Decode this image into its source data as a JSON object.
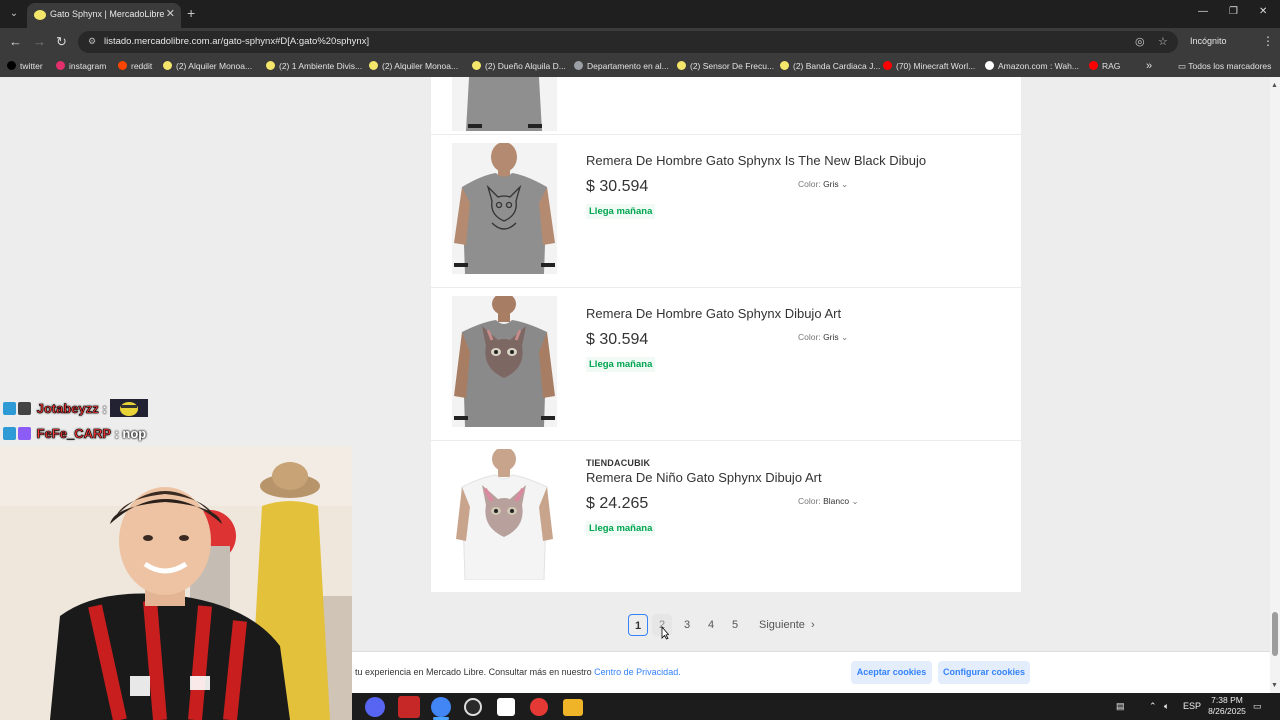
{
  "browser": {
    "tab_title": "Gato Sphynx | MercadoLibre",
    "url": "listado.mercadolibre.com.ar/gato-sphynx#D[A:gato%20sphynx]",
    "incognito_label": "Incógnito",
    "bookmarks": [
      {
        "label": "twitter",
        "icon": "x-icon",
        "color": "#000000"
      },
      {
        "label": "instagram",
        "icon": "instagram-icon",
        "color": "#e1306c"
      },
      {
        "label": "reddit",
        "icon": "reddit-icon",
        "color": "#ff4500"
      },
      {
        "label": "(2) Alquiler Monoa...",
        "icon": "ml-icon",
        "color": "#f3e66b"
      },
      {
        "label": "(2) 1 Ambiente Divis...",
        "icon": "ml-icon",
        "color": "#f3e66b"
      },
      {
        "label": "(2) Alquiler Monoa...",
        "icon": "ml-icon",
        "color": "#f3e66b"
      },
      {
        "label": "(2) Dueño Alquila D...",
        "icon": "ml-icon",
        "color": "#f3e66b"
      },
      {
        "label": "Departamento en al...",
        "icon": "house-icon",
        "color": "#9aa0a6"
      },
      {
        "label": "(2) Sensor De Frecu...",
        "icon": "ml-icon",
        "color": "#f3e66b"
      },
      {
        "label": "(2) Banda Cardiaca J...",
        "icon": "ml-icon",
        "color": "#f3e66b"
      },
      {
        "label": "(70) Minecraft Worl...",
        "icon": "youtube-icon",
        "color": "#ff0000"
      },
      {
        "label": "Amazon.com : Wah...",
        "icon": "amazon-icon",
        "color": "#ffffff"
      },
      {
        "label": "RAG",
        "icon": "youtube-icon",
        "color": "#ff0000"
      }
    ],
    "bookmarks_folder": "Todos los marcadores"
  },
  "products": [
    {
      "seller": "",
      "title": "Remera De Hombre Gato Sphynx Is The New Black Dibujo",
      "price": "$ 30.594",
      "shipping": "Llega mañana",
      "color_label": "Color:",
      "color_value": "Gris",
      "shirt_color": "#8f8f8f"
    },
    {
      "seller": "",
      "title": "Remera De Hombre Gato Sphynx Dibujo Art",
      "price": "$ 30.594",
      "shipping": "Llega mañana",
      "color_label": "Color:",
      "color_value": "Gris",
      "shirt_color": "#8a8a8a"
    },
    {
      "seller": "TIENDACUBIK",
      "title": "Remera De Niño Gato Sphynx Dibujo Art",
      "price": "$ 24.265",
      "shipping": "Llega mañana",
      "color_label": "Color:",
      "color_value": "Blanco",
      "shirt_color": "#f4f4f4"
    }
  ],
  "pagination": {
    "pages": [
      "1",
      "2",
      "3",
      "4",
      "5"
    ],
    "current": "1",
    "next_label": "Siguiente"
  },
  "cookies": {
    "text": "tu experiencia en Mercado Libre. Consultar más en nuestro",
    "link": "Centro de Privacidad.",
    "accept": "Aceptar cookies",
    "configure": "Configurar cookies"
  },
  "chat": [
    {
      "user": "Jotabeyzz",
      "sep": ":",
      "message": ""
    },
    {
      "user": "FeFe_CARP",
      "sep": ":",
      "message": "nop"
    }
  ],
  "taskbar": {
    "language": "ESP",
    "time": "7:38 PM",
    "date": "8/26/2025"
  },
  "colors": {
    "accent": "#3483fa",
    "shipping_green": "#00a650",
    "page_bg": "#ededed"
  }
}
